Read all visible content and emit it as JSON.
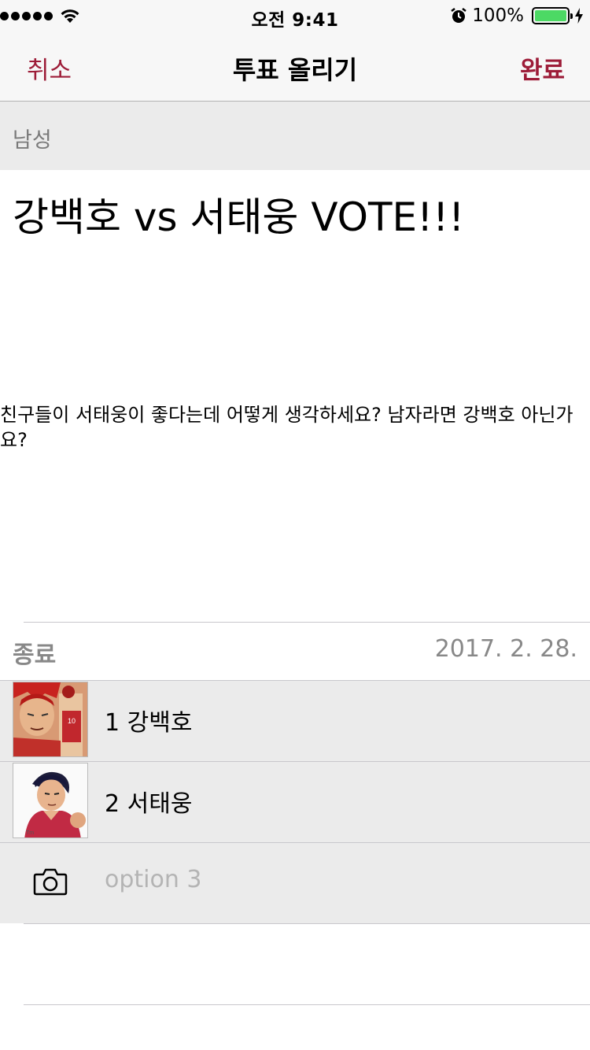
{
  "status_bar": {
    "time": "오전 9:41",
    "battery_text": "100%",
    "battery_level": 1.0,
    "signal_icon": "signal-dots-icon",
    "wifi_icon": "wifi-icon",
    "alarm_icon": "alarm-icon",
    "charging_icon": "charging-bolt-icon",
    "battery_color": "#4cd964"
  },
  "nav": {
    "cancel_label": "취소",
    "title": "투표 올리기",
    "done_label": "완료",
    "accent_color": "#9d1c38"
  },
  "category": {
    "label": "남성"
  },
  "post": {
    "title": "강백호 vs 서태웅 VOTE!!!",
    "body": "친구들이 서태웅이 좋다는데 어떻게 생각하세요? 남자라면 강백호 아닌가요?"
  },
  "end": {
    "label": "종료",
    "date": "2017. 2. 28."
  },
  "options": [
    {
      "number": "1",
      "name": "강백호",
      "text": "1 강백호",
      "image": "player-red-hair-photo"
    },
    {
      "number": "2",
      "name": "서태웅",
      "text": "2 서태웅",
      "image": "player-dark-hair-photo"
    }
  ],
  "new_option": {
    "placeholder": "option 3",
    "value": "",
    "icon": "camera-icon"
  }
}
